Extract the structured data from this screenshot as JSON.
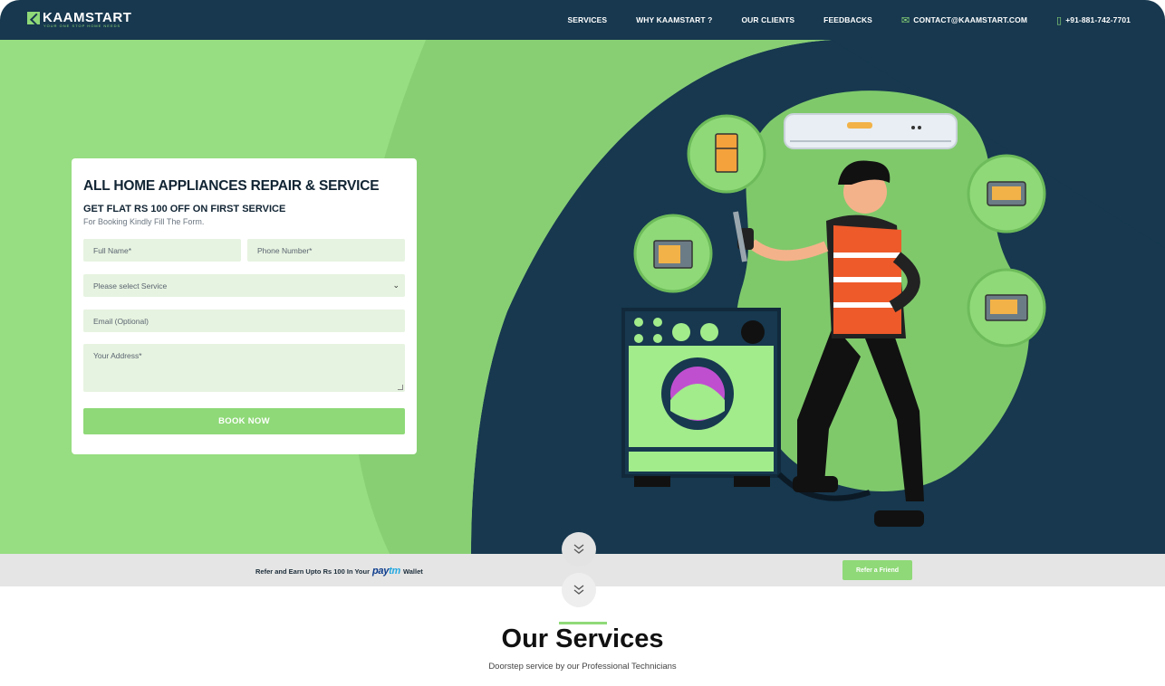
{
  "header": {
    "logo_text": "KAAMSTART",
    "logo_tagline": "YOUR ONE STOP HOME NEEDS",
    "nav": [
      {
        "label": "SERVICES"
      },
      {
        "label": "WHY KAAMSTART ?"
      },
      {
        "label": "OUR CLIENTS"
      },
      {
        "label": "FEEDBACKS"
      }
    ],
    "email": "CONTACT@KAAMSTART.COM",
    "phone": "+91-881-742-7701"
  },
  "form": {
    "title": "ALL HOME APPLIANCES REPAIR & SERVICE",
    "offer": "GET FLAT RS 100 OFF ON FIRST SERVICE",
    "note": "For Booking Kindly Fill The Form.",
    "full_name_placeholder": "Full Name*",
    "phone_placeholder": "Phone Number*",
    "service_select": "Please select Service",
    "email_placeholder": "Email (Optional)",
    "address_placeholder": "Your Address*",
    "submit_label": "BOOK NOW"
  },
  "refer": {
    "text_before": "Refer and Earn Upto Rs 100 In Your",
    "paytm_a": "pay",
    "paytm_b": "tm",
    "text_after": "Wallet",
    "button_label": "Refer a Friend"
  },
  "services": {
    "title": "Our Services",
    "subtitle": "Doorstep service by our Professional Technicians"
  },
  "colors": {
    "navy": "#17384f",
    "accent_green": "#8fd978",
    "light_green": "#e6f3e0"
  },
  "icons": [
    "email-icon",
    "phone-icon",
    "chevron-down-icon",
    "double-chevron-down-icon"
  ]
}
